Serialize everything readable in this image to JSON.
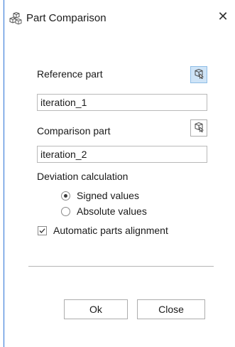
{
  "window": {
    "title": "Part Comparison",
    "close_glyph": "✕"
  },
  "reference": {
    "label": "Reference part",
    "value": "iteration_1",
    "pick_icon": "cube-select-icon"
  },
  "comparison": {
    "label": "Comparison part",
    "value": "iteration_2",
    "pick_icon": "cube-select-icon"
  },
  "deviation": {
    "label": "Deviation calculation",
    "options": [
      {
        "label": "Signed values",
        "selected": true
      },
      {
        "label": "Absolute values",
        "selected": false
      }
    ]
  },
  "alignment": {
    "label": "Automatic parts alignment",
    "checked": true
  },
  "buttons": {
    "ok_label": "Ok",
    "close_label": "Close"
  },
  "colors": {
    "accent": "#2b73d6",
    "active_pick_bg": "#cfe4f7"
  }
}
